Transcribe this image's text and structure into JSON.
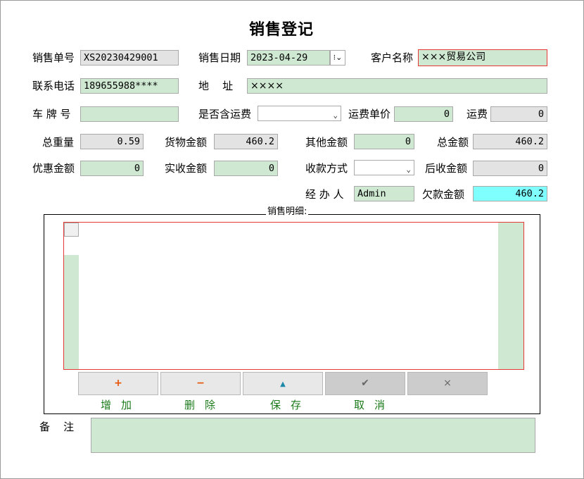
{
  "title": "销售登记",
  "fields": {
    "order_no": {
      "label": "销售单号",
      "value": "XS20230429001"
    },
    "sale_date": {
      "label": "销售日期",
      "value": "2023-04-29"
    },
    "customer": {
      "label": "客户名称",
      "value": "×××贸易公司"
    },
    "phone": {
      "label": "联系电话",
      "value": "189655988****"
    },
    "address": {
      "label": "地    址",
      "value": "××××"
    },
    "plate": {
      "label": "车 牌 号",
      "value": ""
    },
    "freight_incl": {
      "label": "是否含运费",
      "value": ""
    },
    "freight_price": {
      "label": "运费单价",
      "value": "0"
    },
    "freight": {
      "label": "运费",
      "value": "0"
    },
    "total_weight": {
      "label": "总重量",
      "value": "0.59"
    },
    "goods_amount": {
      "label": "货物金额",
      "value": "460.2"
    },
    "other_amount": {
      "label": "其他金额",
      "value": "0"
    },
    "total_amount": {
      "label": "总金额",
      "value": "460.2"
    },
    "discount": {
      "label": "优惠金额",
      "value": "0"
    },
    "received": {
      "label": "实收金额",
      "value": "0"
    },
    "pay_method": {
      "label": "收款方式",
      "value": ""
    },
    "later_received": {
      "label": "后收金额",
      "value": "0"
    },
    "handler": {
      "label": "经 办 人",
      "value": "Admin"
    },
    "owed": {
      "label": "欠款金额",
      "value": "460.2"
    }
  },
  "detail_title": "销售明细:",
  "buttons": [
    {
      "icon": "+",
      "label": "增加"
    },
    {
      "icon": "−",
      "label": "删除"
    },
    {
      "icon": "▲",
      "label": "保存"
    },
    {
      "icon": "✔",
      "label": "取消"
    },
    {
      "icon": "×",
      "label": ""
    }
  ],
  "remark": {
    "label": "备    注",
    "value": ""
  },
  "colors": {
    "field_green": "#cfe8d2",
    "owed_cyan": "#80ffff",
    "required_border": "#e53935"
  }
}
